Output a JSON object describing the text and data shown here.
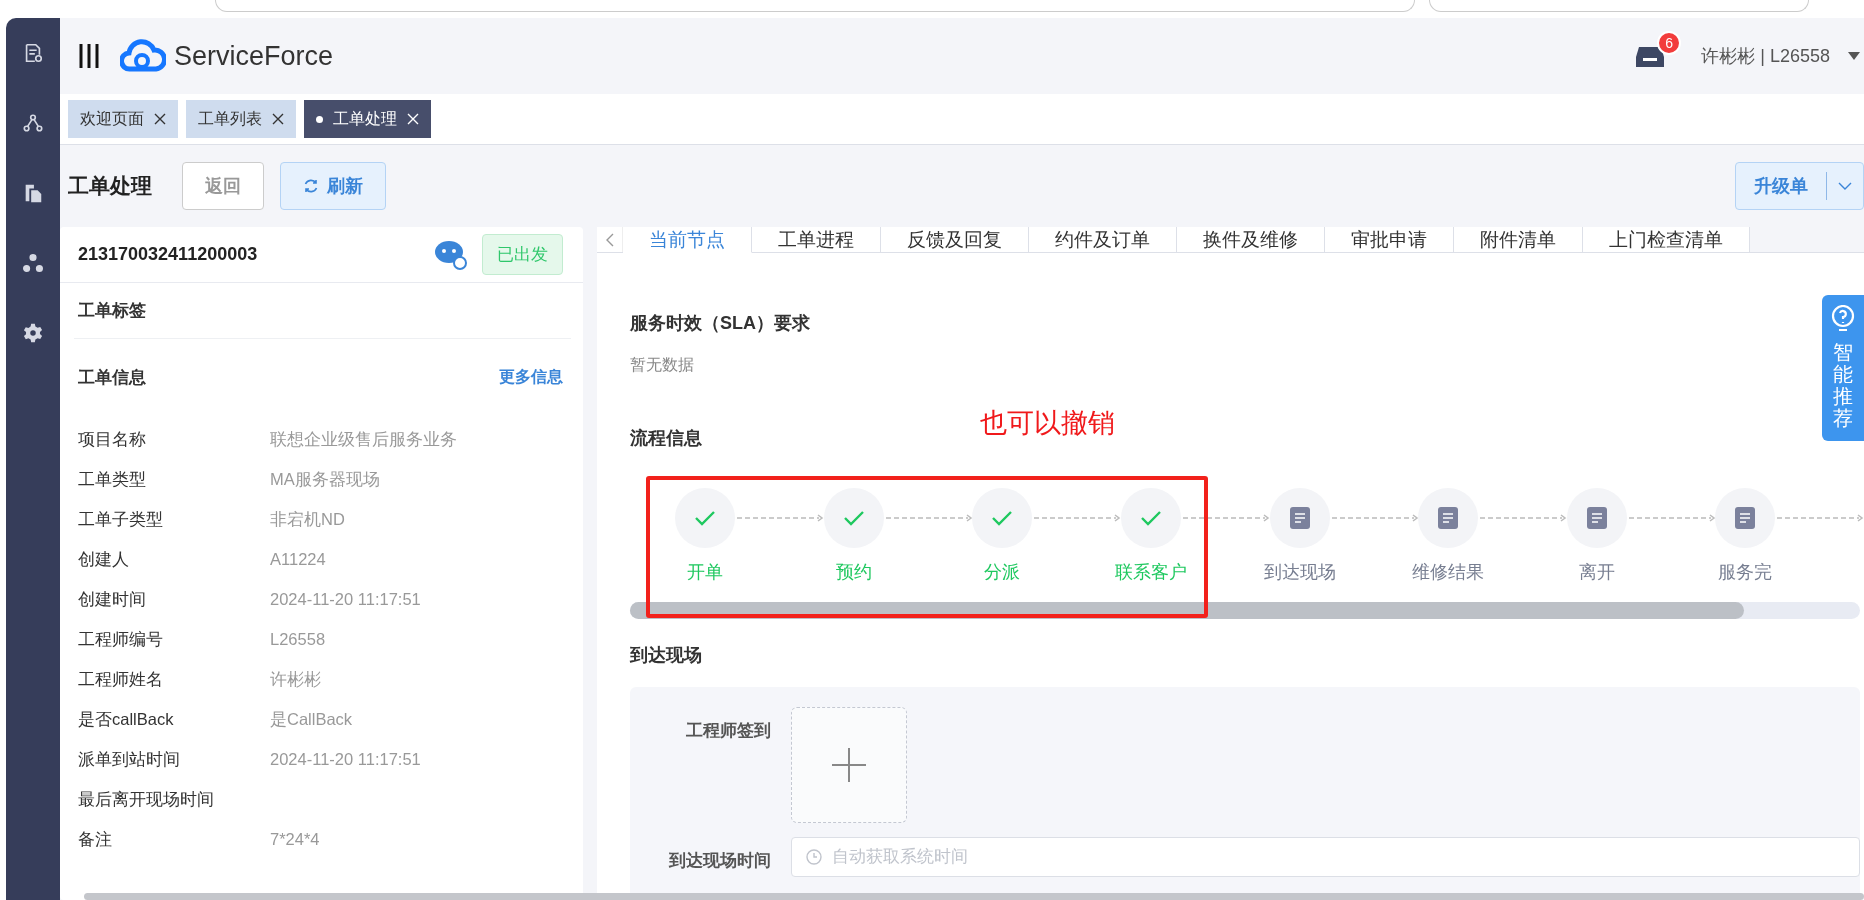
{
  "app": {
    "brand": "ServiceForce",
    "notification_count": "6",
    "user": "许彬彬 | L26558"
  },
  "open_tabs": [
    {
      "label": "欢迎页面",
      "selected": false
    },
    {
      "label": "工单列表",
      "selected": false
    },
    {
      "label": "工单处理",
      "selected": true
    }
  ],
  "page": {
    "title": "工单处理",
    "buttons": [
      {
        "label": "返回",
        "kind": "plain"
      },
      {
        "label": "刷新",
        "kind": "refresh"
      }
    ],
    "split_button": "升级单"
  },
  "order": {
    "number": "213170032411200003",
    "status": "已出发",
    "tag_title": "工单标签",
    "info_title": "工单信息",
    "more_link": "更多信息",
    "fields": [
      {
        "label": "项目名称",
        "value": "联想企业级售后服务业务"
      },
      {
        "label": "工单类型",
        "value": "MA服务器现场"
      },
      {
        "label": "工单子类型",
        "value": "非宕机ND"
      },
      {
        "label": "创建人",
        "value": "A11224"
      },
      {
        "label": "创建时间",
        "value": "2024-11-20 11:17:51"
      },
      {
        "label": "工程师编号",
        "value": "L26558"
      },
      {
        "label": "工程师姓名",
        "value": "许彬彬"
      },
      {
        "label": "是否callBack",
        "value": "是CallBack"
      },
      {
        "label": "派单到站时间",
        "value": "2024-11-20 11:17:51"
      },
      {
        "label": "最后离开现场时间"
      },
      {
        "label": "备注",
        "value": "7*24*4"
      }
    ]
  },
  "detail_tabs": [
    {
      "label": "当前节点",
      "selected": true
    },
    {
      "label": "工单进程",
      "selected": false
    },
    {
      "label": "反馈及回复",
      "selected": false
    },
    {
      "label": "约件及订单",
      "selected": false
    },
    {
      "label": "换件及维修",
      "selected": false
    },
    {
      "label": "审批申请",
      "selected": false
    },
    {
      "label": "附件清单",
      "selected": false
    },
    {
      "label": "上门检查清单",
      "selected": false
    }
  ],
  "sla": {
    "title": "服务时效（SLA）要求",
    "empty": "暂无数据"
  },
  "flow": {
    "title": "流程信息",
    "annotation": "也可以撤销",
    "steps": [
      {
        "label": "开单",
        "done": true
      },
      {
        "label": "预约",
        "done": true
      },
      {
        "label": "分派",
        "done": true
      },
      {
        "label": "联系客户",
        "done": true
      },
      {
        "label": "到达现场",
        "done": false
      },
      {
        "label": "维修结果",
        "done": false
      },
      {
        "label": "离开",
        "done": false
      },
      {
        "label": "服务完",
        "done": false
      }
    ]
  },
  "arrival": {
    "title": "到达现场",
    "fields": [
      {
        "label": "工程师签到",
        "kind": "upload"
      },
      {
        "label": "到达现场时间",
        "kind": "time",
        "placeholder": "自动获取系统时间"
      }
    ]
  },
  "assistant": {
    "label": "智能推荐"
  }
}
